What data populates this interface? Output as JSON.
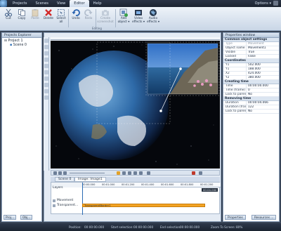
{
  "menu": {
    "items": [
      "Projects",
      "Scenes",
      "View",
      "Editor",
      "Help"
    ],
    "active": "Editor",
    "options": "Options ▾"
  },
  "ribbon": {
    "buttons": [
      {
        "label": "Cut"
      },
      {
        "label": "Copy"
      },
      {
        "label": "Paste"
      },
      {
        "label": "Delete"
      },
      {
        "label": "Select all"
      },
      {
        "label": "Undo"
      },
      {
        "label": "Redo"
      },
      {
        "label": "Create screenshot"
      },
      {
        "label": "Add object ▾"
      },
      {
        "label": "Video effects ▾"
      },
      {
        "label": "Audio effects ▾"
      }
    ],
    "group_label": "Editing"
  },
  "explorer": {
    "title": "Projects Explorer",
    "project": "Project 1",
    "scene": "Scene 0",
    "tabs": [
      "Proj...",
      "Obj..."
    ]
  },
  "stage": {
    "ruler": "",
    "scene_tab": "Scene 0",
    "object_tab": "Image: Image1"
  },
  "timeline": {
    "label": "Layers",
    "ticks": [
      "00:00.000",
      "00:01.000",
      "00:01.200",
      "00:01.400",
      "00:01.600",
      "00:01.800",
      "00:01.200"
    ],
    "time_display": "00:04.000",
    "layers": [
      {
        "name": "Movement",
        "clip": ""
      },
      {
        "name": "Transparent...",
        "clip": "TransparentBorder1"
      }
    ]
  },
  "properties": {
    "title": "Properties window",
    "sections": [
      {
        "title": "Common object settings",
        "rows": [
          {
            "k": "Type",
            "v": "Movement",
            "gray": true
          },
          {
            "k": "Object name",
            "v": "Movement1"
          },
          {
            "k": "Visible",
            "v": "True"
          },
          {
            "k": "Locked",
            "v": "False"
          }
        ]
      },
      {
        "title": "Coordinates",
        "rows": [
          {
            "k": "Y1",
            "v": "502.000"
          },
          {
            "k": "Y1",
            "v": "188.000"
          },
          {
            "k": "X2",
            "v": "424.000"
          },
          {
            "k": "Y2",
            "v": "380.000"
          }
        ]
      },
      {
        "title": "Creating time",
        "rows": [
          {
            "k": "Time",
            "v": "00:00:00.000"
          },
          {
            "k": "Time (frame)",
            "v": "0"
          },
          {
            "k": "Lock to parent",
            "v": "No"
          }
        ]
      },
      {
        "title": "Removing time",
        "rows": [
          {
            "k": "Duration",
            "v": "00:00:04.066"
          },
          {
            "k": "Duration (fran",
            "v": "122"
          },
          {
            "k": "Lock to parent",
            "v": "No"
          }
        ]
      }
    ],
    "tabs": [
      "Properties",
      "Resources ..."
    ]
  },
  "status": {
    "items": [
      "Position:",
      "00:00:00.000",
      "Start selection:",
      "00:00:00.000",
      "End selection:",
      "00:00:00.000",
      "Zoom To Screen:",
      "80%"
    ]
  },
  "colors": {
    "accent": "#2b6bb3",
    "clip": "#f4a322"
  }
}
